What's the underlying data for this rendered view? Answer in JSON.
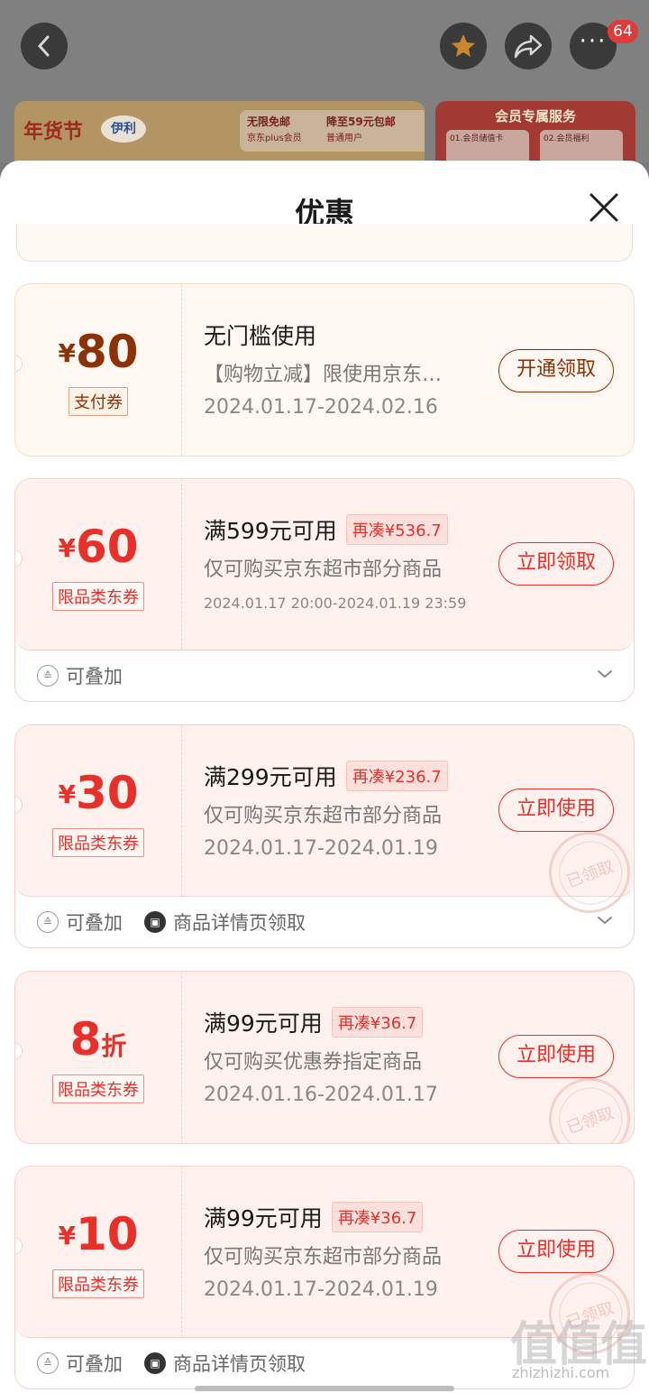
{
  "header": {
    "cart_badge": "64",
    "banner_left": {
      "festival_text": "年货节",
      "brand_text": "伊利",
      "promo_line1": "无限免邮",
      "promo_line2": "京东plus会员",
      "promo_right1": "降至59元包邮",
      "promo_right2": "普通用户"
    },
    "banner_right": {
      "title": "会员专属服务",
      "slot1": "01.会员储值卡",
      "slot2": "02.会员福利"
    }
  },
  "sheet": {
    "title": "优惠"
  },
  "coupons": [
    {
      "currency": "¥",
      "amount": "80",
      "unit": "",
      "tag": "支付券",
      "condition": "无门槛使用",
      "need": "",
      "description": "【购物立减】限使用京东…",
      "date": "2024.01.17-2024.02.16",
      "action": "开通领取",
      "style": "gold",
      "claimed": false,
      "footer": []
    },
    {
      "currency": "¥",
      "amount": "60",
      "unit": "",
      "tag": "限品类东券",
      "condition": "满599元可用",
      "need": "再凑¥536.7",
      "description": "仅可购买京东超市部分商品",
      "date": "2024.01.17 20:00-2024.01.19 23:59",
      "action": "立即领取",
      "style": "red",
      "claimed": false,
      "footer": [
        "可叠加"
      ]
    },
    {
      "currency": "¥",
      "amount": "30",
      "unit": "",
      "tag": "限品类东券",
      "condition": "满299元可用",
      "need": "再凑¥236.7",
      "description": "仅可购买京东超市部分商品",
      "date": "2024.01.17-2024.01.19",
      "action": "立即使用",
      "style": "red",
      "claimed": true,
      "footer": [
        "可叠加",
        "商品详情页领取"
      ]
    },
    {
      "currency": "",
      "amount": "8",
      "unit": "折",
      "tag": "限品类东券",
      "condition": "满99元可用",
      "need": "再凑¥36.7",
      "description": "仅可购买优惠券指定商品",
      "date": "2024.01.16-2024.01.17",
      "action": "立即使用",
      "style": "red",
      "claimed": true,
      "footer": []
    },
    {
      "currency": "¥",
      "amount": "10",
      "unit": "",
      "tag": "限品类东券",
      "condition": "满99元可用",
      "need": "再凑¥36.7",
      "description": "仅可购买京东超市部分商品",
      "date": "2024.01.17-2024.01.19",
      "action": "立即使用",
      "style": "red",
      "claimed": true,
      "footer": [
        "可叠加",
        "商品详情页领取"
      ]
    }
  ],
  "stamp_text": "已领取",
  "watermark": {
    "big": "值值值",
    "small": "zhizhizhi.com"
  },
  "colors": {
    "accent_red": "#e8302a",
    "gold_brown": "#8c3208"
  }
}
